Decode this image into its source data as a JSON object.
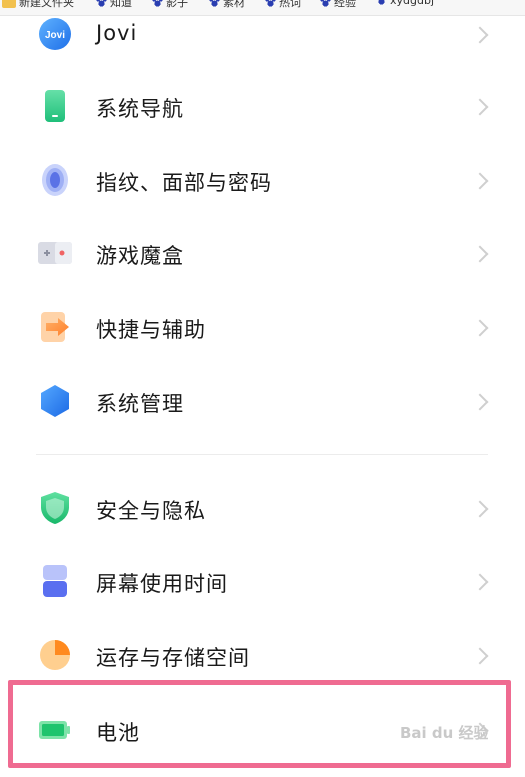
{
  "bookmarks_bar": {
    "items": [
      {
        "label": "新建文件夹",
        "icon": "folder-icon"
      },
      {
        "label": "知道",
        "icon": "baidu-paw-icon"
      },
      {
        "label": "影子",
        "icon": "baidu-paw-icon"
      },
      {
        "label": "素材",
        "icon": "baidu-paw-icon"
      },
      {
        "label": "热词",
        "icon": "baidu-paw-icon"
      },
      {
        "label": "经验",
        "icon": "baidu-paw-icon"
      },
      {
        "label": "xydgdbj",
        "icon": "baidu-paw-icon"
      }
    ]
  },
  "settings": {
    "items": [
      {
        "label": "Jovi",
        "icon": "jovi-icon"
      },
      {
        "label": "系统导航",
        "icon": "phone-icon"
      },
      {
        "label": "指纹、面部与密码",
        "icon": "fingerprint-icon"
      },
      {
        "label": "游戏魔盒",
        "icon": "gamepad-icon"
      },
      {
        "label": "快捷与辅助",
        "icon": "shortcut-arrow-icon"
      },
      {
        "label": "系统管理",
        "icon": "hexagon-icon"
      },
      {
        "label": "安全与隐私",
        "icon": "shield-icon"
      },
      {
        "label": "屏幕使用时间",
        "icon": "hourglass-icon"
      },
      {
        "label": "运存与存储空间",
        "icon": "pie-icon"
      },
      {
        "label": "电池",
        "icon": "battery-icon"
      }
    ],
    "jovi_badge": "Jovi"
  },
  "watermark": {
    "text": "Bai du 经验"
  },
  "colors": {
    "highlight": "#ef6b91",
    "chevron": "#cfcfcf"
  }
}
